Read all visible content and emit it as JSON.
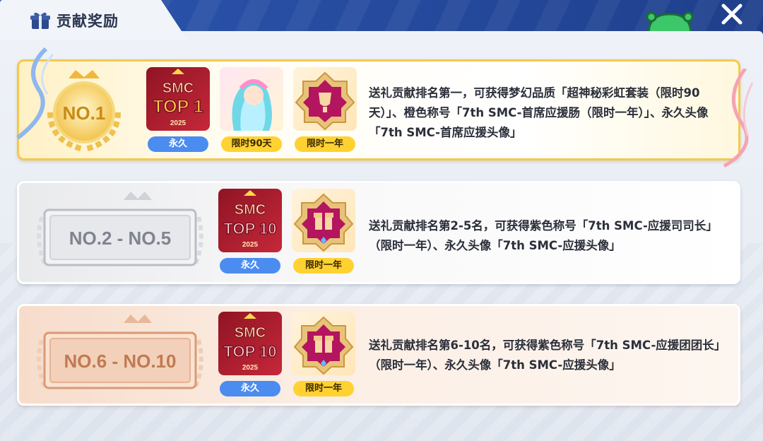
{
  "header": {
    "title": "贡献奖励",
    "close_label": "✕"
  },
  "colors": {
    "accent_blue": "#4b8cf0",
    "accent_yellow": "#ffd231",
    "gold": "#f4c94d",
    "magenta": "#b3155f"
  },
  "rewards": [
    {
      "rank_label": "NO.1",
      "items": [
        {
          "icon": "top1-frame-icon",
          "art_title": "SMC",
          "art_rank": "TOP 1",
          "art_year": "2025",
          "duration": "永久"
        },
        {
          "icon": "rainbow-outfit-icon",
          "duration": "限时90天"
        },
        {
          "icon": "title-badge-icon",
          "duration": "限时一年"
        }
      ],
      "description": "送礼贡献排名第一，可获得梦幻品质「超神秘彩虹套装（限时90天）」、橙色称号「7th SMC-首席应援肠（限时一年）」、永久头像「7th SMC-首席应援头像」"
    },
    {
      "rank_label": "NO.2 - NO.5",
      "items": [
        {
          "icon": "top10-frame-icon",
          "art_title": "SMC",
          "art_rank": "TOP 10",
          "art_year": "2025",
          "duration": "永久"
        },
        {
          "icon": "title-badge-icon",
          "duration": "限时一年"
        }
      ],
      "description": "送礼贡献排名第2-5名，可获得紫色称号「7th SMC-应援司司长」（限时一年）、永久头像「7th SMC-应援头像」"
    },
    {
      "rank_label": "NO.6 - NO.10",
      "items": [
        {
          "icon": "top10-frame-icon",
          "art_title": "SMC",
          "art_rank": "TOP 10",
          "art_year": "2025",
          "duration": "永久"
        },
        {
          "icon": "title-badge-icon",
          "duration": "限时一年"
        }
      ],
      "description": "送礼贡献排名第6-10名，可获得紫色称号「7th SMC-应援团团长」（限时一年）、永久头像「7th SMC-应援头像」"
    }
  ]
}
